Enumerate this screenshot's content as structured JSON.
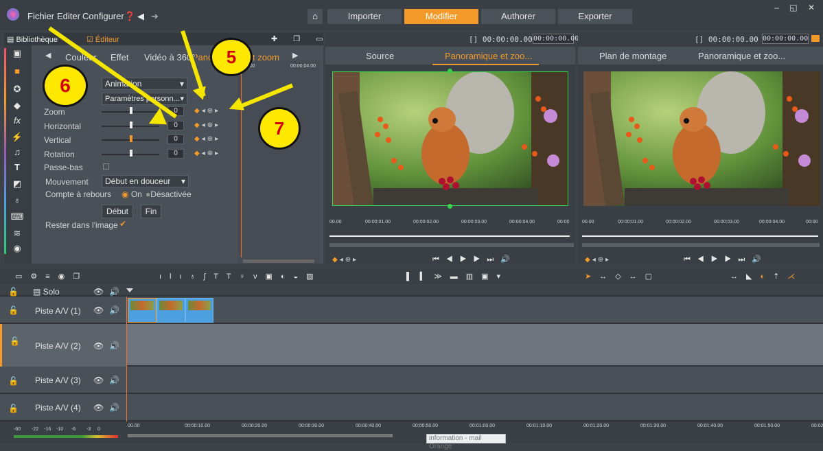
{
  "menubar": {
    "file": "Fichier",
    "edit": "Editer",
    "configure": "Configurer"
  },
  "nav": {
    "import": "Importer",
    "edit": "Modifier",
    "author": "Authorer",
    "export": "Exporter"
  },
  "library": {
    "tab_library": "Bibliothèque",
    "tab_editor": "Éditeur"
  },
  "subtabs": {
    "color": "Couleur",
    "effect": "Effet",
    "video360": "Vidéo à 360°",
    "panzoom": "Panoramique et zoom"
  },
  "keytimeline": {
    "start": "00:00",
    "end": "00:00:04.00"
  },
  "editor": {
    "animation": "Animation",
    "preset": "Paramètres personn...",
    "zoom_label": "Zoom",
    "zoom_value": "0",
    "horizontal_label": "Horizontal",
    "horizontal_value": "0",
    "vertical_label": "Vertical",
    "vertical_value": "0",
    "rotation_label": "Rotation",
    "rotation_value": "0",
    "lowpass_label": "Passe-bas",
    "movement_label": "Mouvement",
    "movement_value": "Début en douceur",
    "countdown_label": "Compte à rebours",
    "countdown_on": "On",
    "countdown_off": "Désactivée",
    "start_btn": "Début",
    "end_btn": "Fin",
    "stay_label": "Rester dans l'image"
  },
  "preview1": {
    "tc": "[] 00:00:00.00",
    "tclabel": "TC",
    "tcvalue": "00:00:00.00",
    "tab_source": "Source",
    "tab_pan": "Panoramique et zoo...",
    "ruler": [
      "00.00",
      "00:00:01.00",
      "00:00:02.00",
      "00:00:03.00",
      "00:00:04.00",
      "00:00"
    ]
  },
  "preview2": {
    "tc": "[] 00:00:00.00",
    "tclabel": "TC",
    "tcvalue": "00:00:00.00",
    "tab_timeline": "Plan de montage",
    "tab_pan": "Panoramique et zoo...",
    "ruler": [
      "00.00",
      "00:00:01.00",
      "00:00:02.00",
      "00:00:03.00",
      "00:00:04.00",
      "00:00"
    ]
  },
  "tracks": {
    "solo": "Solo",
    "t1": "Piste A/V (1)",
    "t2": "Piste A/V (2)",
    "t3": "Piste A/V (3)",
    "t4": "Piste A/V (4)"
  },
  "timeline_ruler": [
    "00.00",
    "00:00:10.00",
    "00:00:20.00",
    "00:00:30.00",
    "00:00:40.00",
    "00:00:50.00",
    "00:01:00.00",
    "00:01:10.00",
    "00:01:20.00",
    "00:01:30.00",
    "00:01:40.00",
    "00:01:50.00",
    "00:02"
  ],
  "meter": [
    "-60",
    "-22",
    "-16",
    "-10",
    "-6",
    "-3",
    "0"
  ],
  "tooltip": "information - mail Orange",
  "annotations": {
    "a5": "5",
    "a6": "6",
    "a7": "7"
  },
  "colors": {
    "accent": "#f39a2a",
    "annotation_yellow": "#ffe800",
    "annotation_red": "#d40000",
    "clip_blue": "#4ca0e0"
  }
}
